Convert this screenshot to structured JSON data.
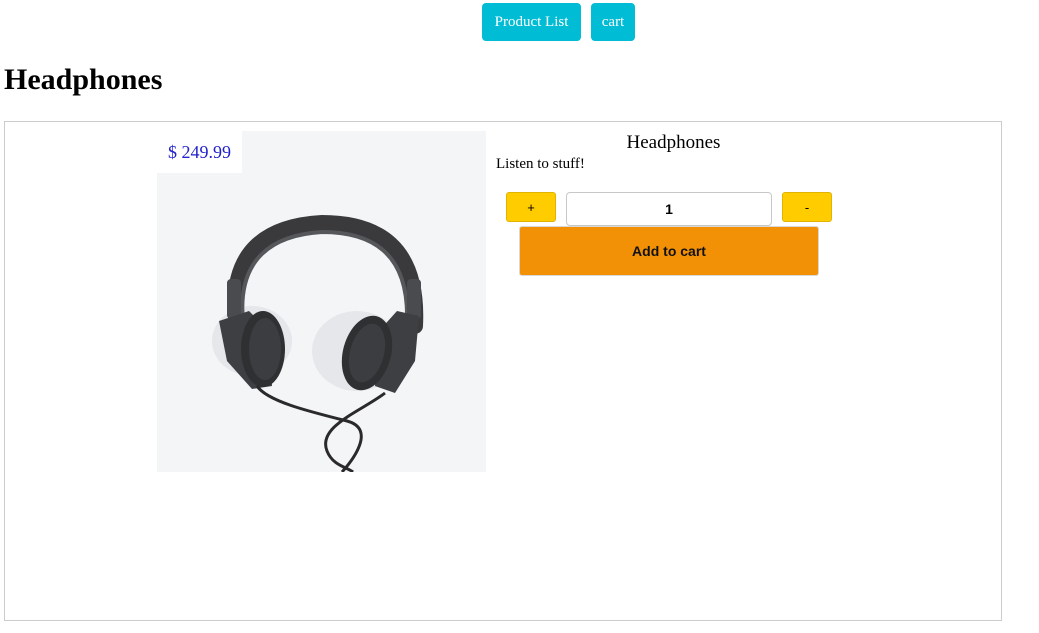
{
  "nav": {
    "product_list_label": "Product List",
    "cart_label": "cart"
  },
  "page": {
    "title": "Headphones"
  },
  "product": {
    "price": "$ 249.99",
    "name": "Headphones",
    "description": "Listen to stuff!",
    "quantity": "1",
    "increment_label": "+",
    "decrement_label": "-",
    "add_to_cart_label": "Add to cart",
    "image_icon": "headphones-image"
  },
  "colors": {
    "nav_button": "#00bcd4",
    "price_text": "#2222cc",
    "qty_button": "#ffcc00",
    "add_to_cart": "#f29106"
  }
}
